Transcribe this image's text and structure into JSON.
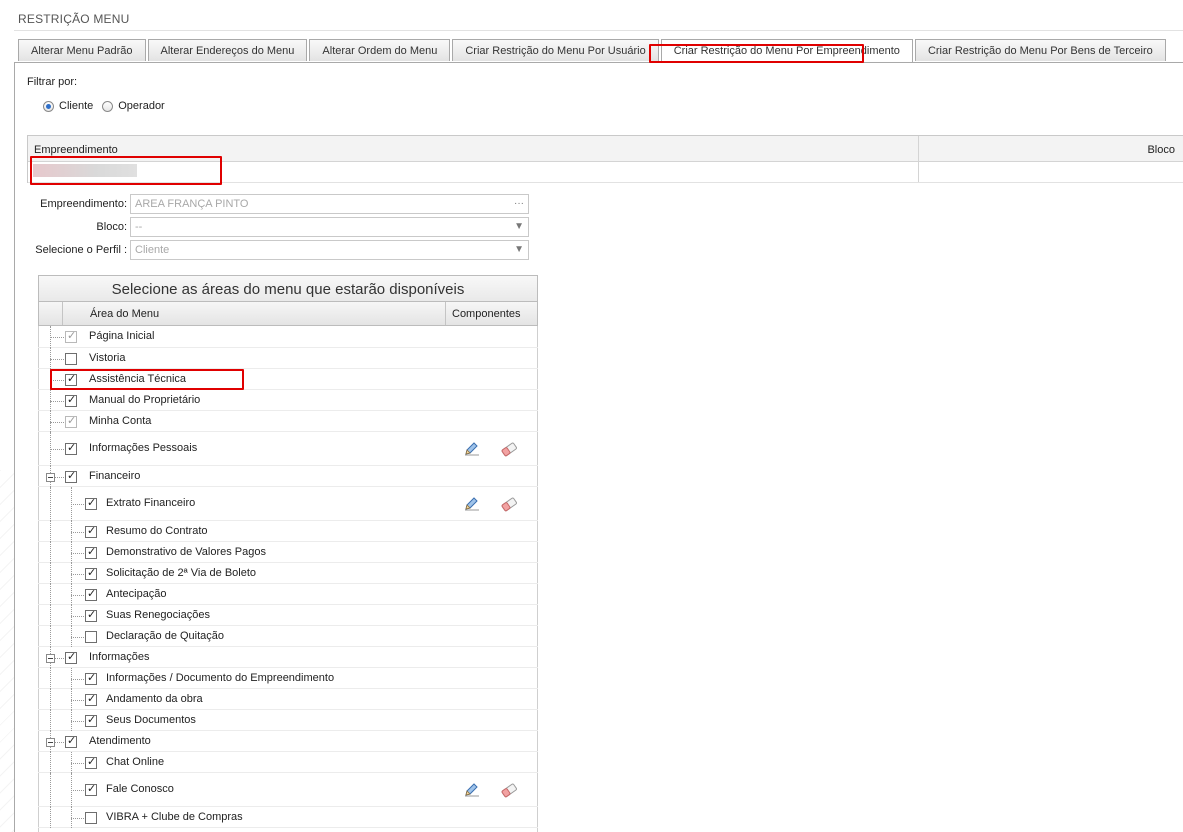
{
  "page": {
    "title": "RESTRIÇÃO MENU"
  },
  "tabs": [
    {
      "label": "Alterar Menu Padrão",
      "active": false
    },
    {
      "label": "Alterar Endereços do Menu",
      "active": false
    },
    {
      "label": "Alterar Ordem do Menu",
      "active": false
    },
    {
      "label": "Criar Restrição do Menu Por Usuário",
      "active": false
    },
    {
      "label": "Criar Restrição do Menu Por Empreendimento",
      "active": true
    },
    {
      "label": "Criar Restrição do Menu Por Bens de Terceiro",
      "active": false
    }
  ],
  "filter": {
    "label": "Filtrar por:",
    "options": [
      {
        "label": "Cliente",
        "selected": true
      },
      {
        "label": "Operador",
        "selected": false
      }
    ]
  },
  "grid": {
    "columns": [
      "Empreendimento",
      "Bloco"
    ]
  },
  "form": {
    "empreendimento": {
      "label": "Empreendimento:",
      "value": "AREA FRANÇA PINTO",
      "button": "···"
    },
    "bloco": {
      "label": "Bloco:",
      "value": "--"
    },
    "perfil": {
      "label": "Selecione o Perfil :",
      "value": "Cliente"
    }
  },
  "menu": {
    "title": "Selecione as áreas do menu que estarão disponíveis",
    "col_area": "Área do Menu",
    "col_components": "Componentes",
    "items": [
      {
        "label": "Página Inicial",
        "checked": true,
        "disabled": true
      },
      {
        "label": "Vistoria",
        "checked": false
      },
      {
        "label": "Assistência Técnica",
        "checked": true
      },
      {
        "label": "Manual do Proprietário",
        "checked": true
      },
      {
        "label": "Minha Conta",
        "checked": true,
        "disabled": true
      },
      {
        "label": "Informações Pessoais",
        "checked": true,
        "components": true
      },
      {
        "label": "Financeiro",
        "checked": true,
        "expander": true
      },
      {
        "label": "Extrato Financeiro",
        "checked": true,
        "components": true
      },
      {
        "label": "Resumo do Contrato",
        "checked": true
      },
      {
        "label": "Demonstrativo de Valores Pagos",
        "checked": true
      },
      {
        "label": "Solicitação de 2ª Via de Boleto",
        "checked": true
      },
      {
        "label": "Antecipação",
        "checked": true
      },
      {
        "label": "Suas Renegociações",
        "checked": true
      },
      {
        "label": "Declaração de Quitação",
        "checked": false
      },
      {
        "label": "Informações",
        "checked": true,
        "expander": true
      },
      {
        "label": "Informações / Documento do Empreendimento",
        "checked": true
      },
      {
        "label": "Andamento da obra",
        "checked": true
      },
      {
        "label": "Seus Documentos",
        "checked": true
      },
      {
        "label": "Atendimento",
        "checked": true,
        "expander": true
      },
      {
        "label": "Chat Online",
        "checked": true
      },
      {
        "label": "Fale Conosco",
        "checked": true,
        "components": true
      },
      {
        "label": "VIBRA + Clube de Compras",
        "checked": false
      }
    ]
  },
  "icons": {
    "edit": "pencil-icon",
    "clear": "eraser-icon",
    "highlight_color": "#e00000"
  }
}
